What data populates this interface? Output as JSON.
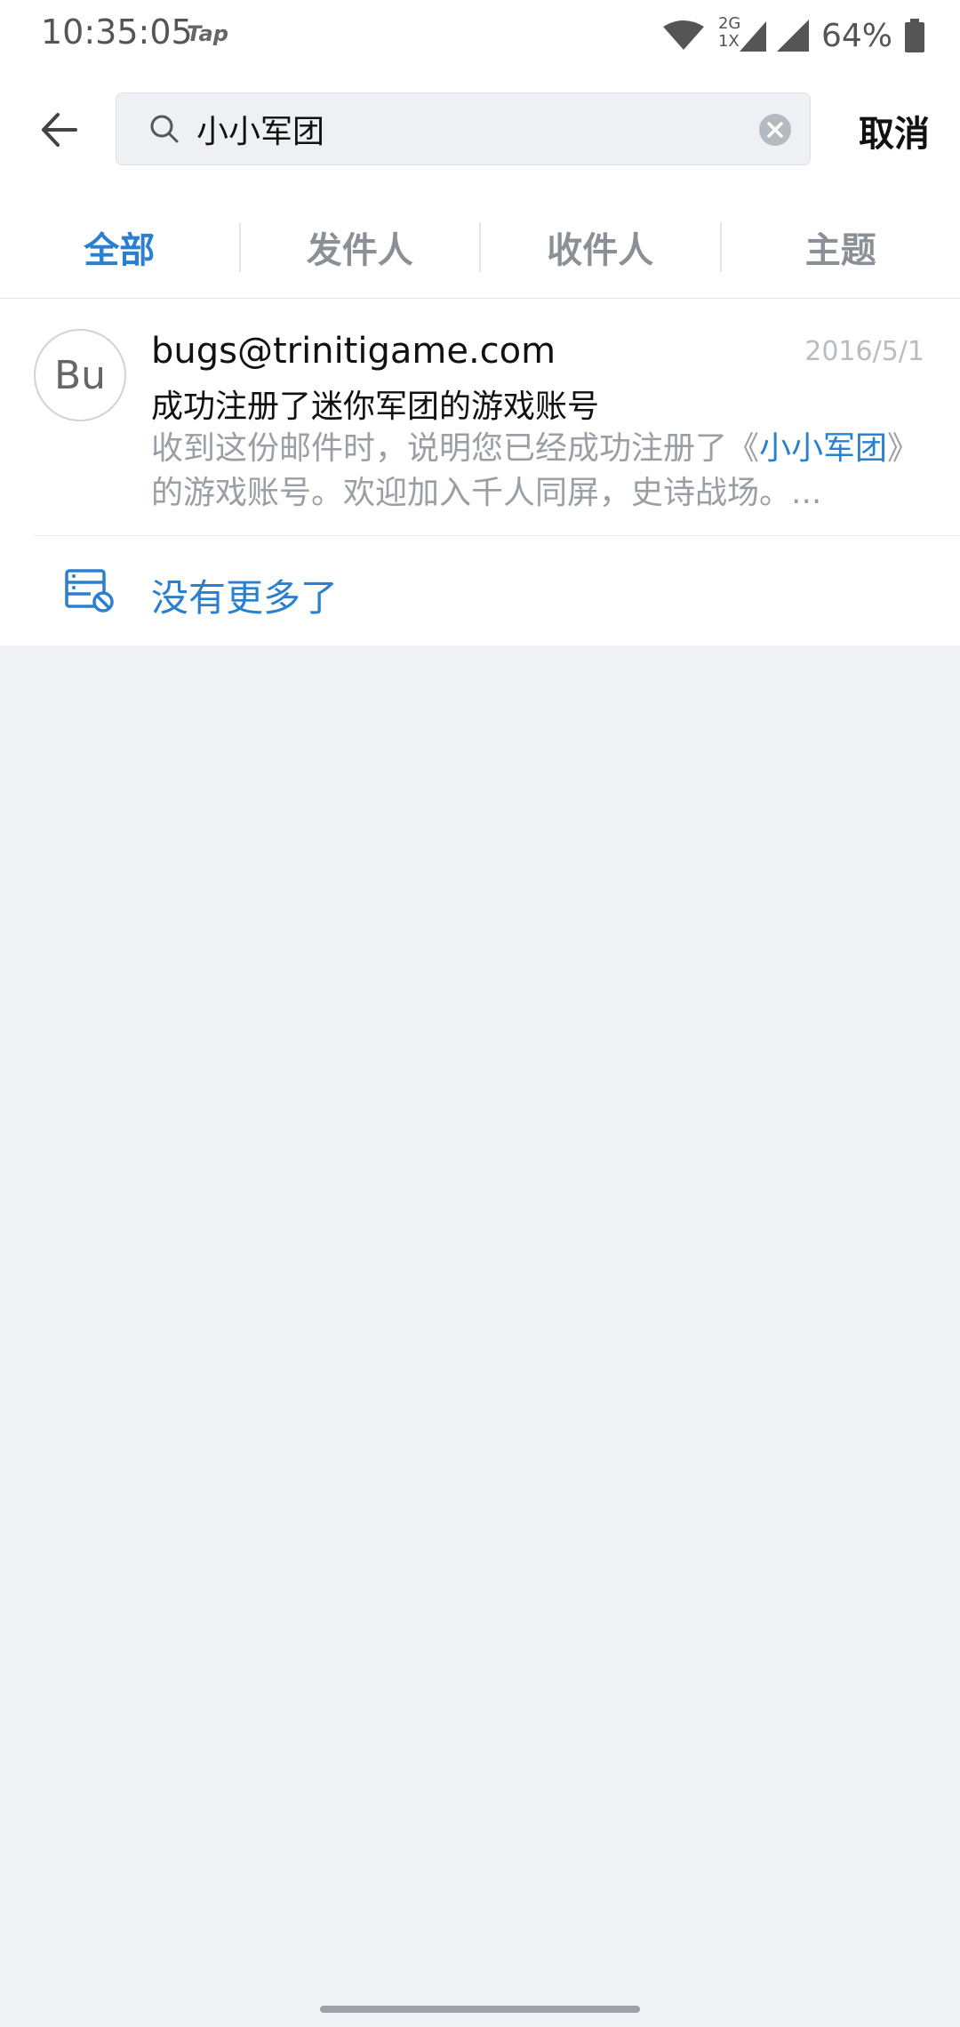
{
  "status_bar": {
    "time": "10:35:05",
    "tap_label": "Tap",
    "network_2g": "2G",
    "network_1x": "1X",
    "battery_percent": "64%"
  },
  "search": {
    "query": "小小军团",
    "cancel_label": "取消"
  },
  "tabs": [
    {
      "label": "全部",
      "active": true
    },
    {
      "label": "发件人",
      "active": false
    },
    {
      "label": "收件人",
      "active": false
    },
    {
      "label": "主题",
      "active": false
    }
  ],
  "mail_list": [
    {
      "avatar_initials": "Bu",
      "sender": "bugs@trinitigame.com",
      "date": "2016/5/1",
      "subject": "成功注册了迷你军团的游戏账号",
      "preview_before": "收到这份邮件时，说明您已经成功注册了《",
      "preview_highlight": "小小军团",
      "preview_after": "》的游戏账号。欢迎加入千人同屏，史诗战场。..."
    }
  ],
  "no_more_label": "没有更多了",
  "colors": {
    "accent": "#2b7fd0",
    "background": "#f1f3f7"
  }
}
